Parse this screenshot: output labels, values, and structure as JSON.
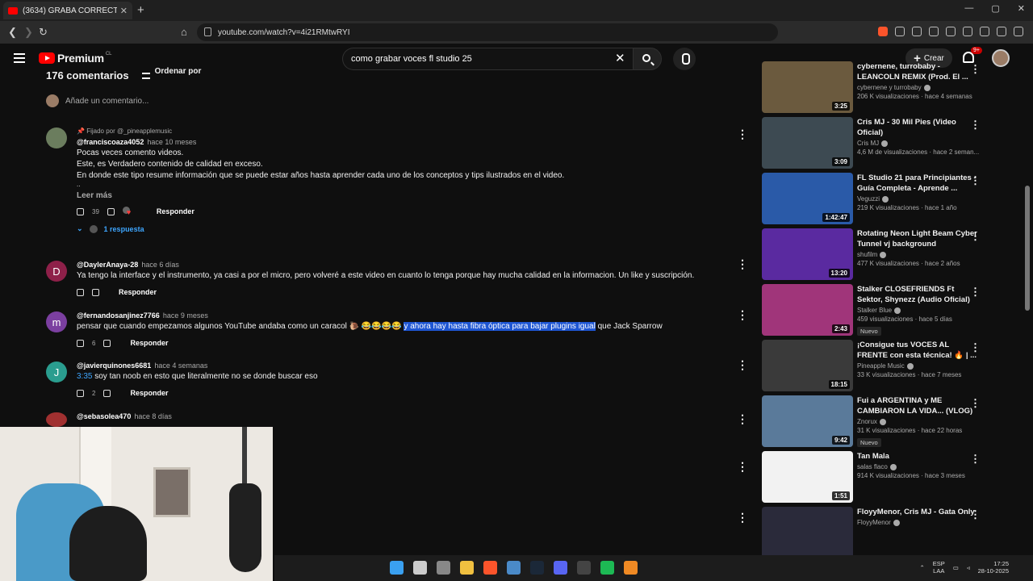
{
  "browser": {
    "tab_title": "(3634) GRABA CORRECTAMENTE",
    "tab_close": "✕",
    "new_tab": "+",
    "url": "youtube.com/watch?v=4i21RMtwRYI",
    "window_controls": [
      "—",
      "▢",
      "✕"
    ]
  },
  "yt": {
    "logo_text": "Premium",
    "country": "CL",
    "search_query": "como grabar voces fl studio 25",
    "search_clear": "✕",
    "create_label": "Crear",
    "create_plus": "+",
    "notif_badge": "9+"
  },
  "comments": {
    "count_label": "176 comentarios",
    "sort_label": "Ordenar por",
    "add_placeholder": "Añade un comentario...",
    "items": [
      {
        "pinned": "Fijado por @_pineapplemusic",
        "handle": "@franciscoaza4052",
        "time": "hace 10 meses",
        "lines": [
          "Pocas veces comento videos.",
          "Este, es Verdadero contenido de calidad en exceso.",
          "En donde este tipo resume información que se puede estar años hasta aprender cada uno de los conceptos y tips ilustrados en el video.",
          ".."
        ],
        "read_more": "Leer más",
        "likes": "39",
        "reply": "Responder",
        "replies": "1 respuesta",
        "avatar_color": "#6b7d5e"
      },
      {
        "handle": "@DaylerAnaya-28",
        "time": "hace 6 días",
        "text": "Ya tengo la interface y el instrumento, ya casi a por el micro, pero volveré a este video en cuanto lo tenga porque hay mucha calidad en la informacion. Un like y suscripción.",
        "likes": "",
        "reply": "Responder",
        "avatar_letter": "D",
        "avatar_color": "#8e2049"
      },
      {
        "handle": "@fernandosanjinez7766",
        "time": "hace 9 meses",
        "text_before": "pensar que cuando empezamos algunos  YouTube andaba como un caracol 🐌  😂😂😂😂 ",
        "text_highlight": "y ahora hay hasta fibra óptica para bajar plugins igual",
        "text_after": " que Jack Sparrow",
        "likes": "6",
        "reply": "Responder",
        "avatar_letter": "m",
        "avatar_color": "#7b3fa0"
      },
      {
        "handle": "@javierquinones6681",
        "time": "hace 4 semanas",
        "timestamp": "3:35",
        "text": " soy tan noob en esto que literalmente no se donde buscar eso",
        "likes": "2",
        "reply": "Responder",
        "avatar_letter": "J",
        "avatar_color": "#2a9d8f"
      },
      {
        "handle": "@sebasolea470",
        "time": "hace 8 días",
        "avatar_color": "#a03030"
      }
    ]
  },
  "sidebar": {
    "videos": [
      {
        "title": "cybernene, turrobaby - LEANCOLN REMIX (Prod. El ...",
        "channel": "cybernene y turrobaby",
        "stats": "206 K visualizaciones · hace 4 semanas",
        "duration": "3:25",
        "new": "",
        "thumb": "#6b5a3e"
      },
      {
        "title": "Cris MJ - 30 Mil Pies (Video Oficial)",
        "channel": "Cris MJ",
        "stats": "4,6 M de visualizaciones · hace 2 seman...",
        "duration": "3:09",
        "new": "",
        "thumb": "#3d4a52"
      },
      {
        "title": "FL Studio 21 para Principiantes - Guía Completa - Aprende ...",
        "channel": "Veguzzi",
        "stats": "219 K visualizaciones · hace 1 año",
        "duration": "1:42:47",
        "new": "",
        "thumb": "#2a5aa8"
      },
      {
        "title": "Rotating Neon Light Beam Cyber Tunnel vj background",
        "channel": "shufilm",
        "stats": "477 K visualizaciones · hace 2 años",
        "duration": "13:20",
        "new": "",
        "thumb": "#5a2aa0"
      },
      {
        "title": "Stalker CLOSEFRIENDS Ft Sektor, Shynezz (Audio Oficial)",
        "channel": "Stalker Blue",
        "stats": "459 visualizaciones · hace 5 días",
        "duration": "2:43",
        "new": "Nuevo",
        "thumb": "#a0357a"
      },
      {
        "title": "¡Consigue tus VOCES AL FRENTE con esta técnica! 🔥 | ...",
        "channel": "Pineapple Music",
        "stats": "33 K visualizaciones · hace 7 meses",
        "duration": "18:15",
        "new": "",
        "thumb": "#3a3a3a"
      },
      {
        "title": "Fui a ARGENTINA y ME CAMBIARON LA VIDA... (VLOG)",
        "channel": "Znorux",
        "stats": "31 K visualizaciones · hace 22 horas",
        "duration": "9:42",
        "new": "Nuevo",
        "thumb": "#5a7a9a"
      },
      {
        "title": "Tan Mala",
        "channel": "salas flaco",
        "stats": "914 K visualizaciones · hace 3 meses",
        "duration": "1:51",
        "new": "",
        "thumb": "#f2f2f2"
      },
      {
        "title": "FloyyMenor, Cris MJ - Gata Only",
        "channel": "FloyyMenor",
        "stats": "",
        "duration": "",
        "new": "",
        "thumb": "#2a2a3a"
      }
    ]
  },
  "tray": {
    "lang": "ESP",
    "layout": "LAA",
    "time": "17:25",
    "date": "28-10-2025"
  },
  "taskbar_icons": [
    {
      "name": "start-icon",
      "color": "#3aa0f0"
    },
    {
      "name": "search-icon",
      "color": "#cccccc"
    },
    {
      "name": "task-view-icon",
      "color": "#888888"
    },
    {
      "name": "file-explorer-icon",
      "color": "#f0c040"
    },
    {
      "name": "brave-icon",
      "color": "#fb542b"
    },
    {
      "name": "photos-icon",
      "color": "#4a8ac8"
    },
    {
      "name": "steam-icon",
      "color": "#1b2838"
    },
    {
      "name": "discord-icon",
      "color": "#5865f2"
    },
    {
      "name": "obs-icon",
      "color": "#444444"
    },
    {
      "name": "spotify-icon",
      "color": "#1db954"
    },
    {
      "name": "fl-studio-icon",
      "color": "#f08a24"
    }
  ]
}
